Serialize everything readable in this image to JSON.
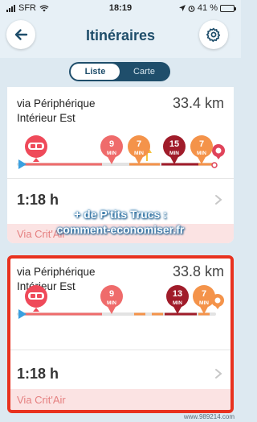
{
  "status": {
    "carrier": "SFR",
    "time": "18:19",
    "battery": "41 %",
    "battery_level": 0.41
  },
  "header": {
    "title": "Itinéraires"
  },
  "view_toggle": {
    "options": [
      "Liste",
      "Carte"
    ],
    "selected": "Liste"
  },
  "routes": [
    {
      "name": "via Périphérique Intérieur Est",
      "distance": "33.4 km",
      "duration": "1:18 h",
      "critair": "Via Crit'Air",
      "delays": [
        {
          "value": "9",
          "unit": "MIN",
          "color": "#ef6b6b"
        },
        {
          "value": "7",
          "unit": "MIN",
          "color": "#f4934a"
        },
        {
          "value": "15",
          "unit": "MIN",
          "color": "#a01c2a"
        },
        {
          "value": "7",
          "unit": "MIN",
          "color": "#f4934a"
        }
      ]
    },
    {
      "name": "via Périphérique Intérieur Est",
      "distance": "33.8 km",
      "duration": "1:18 h",
      "critair": "Via Crit'Air",
      "delays": [
        {
          "value": "9",
          "unit": "MIN",
          "color": "#ef6b6b"
        },
        {
          "value": "13",
          "unit": "MIN",
          "color": "#a01c2a"
        },
        {
          "value": "7",
          "unit": "MIN",
          "color": "#f4934a"
        }
      ]
    }
  ],
  "watermark": {
    "line1": "+ de P'tits Trucs :",
    "line2": "comment-economiser.fr"
  },
  "credit": "www.989214.com",
  "colors": {
    "accent": "#1f4e6b",
    "selected_border": "#e8321f",
    "critair_bg": "#fbe3e3"
  },
  "icons": [
    "back-arrow-icon",
    "settings-gear-icon",
    "car-marker-icon",
    "destination-pin-icon",
    "chevron-right-icon",
    "warning-icon"
  ]
}
